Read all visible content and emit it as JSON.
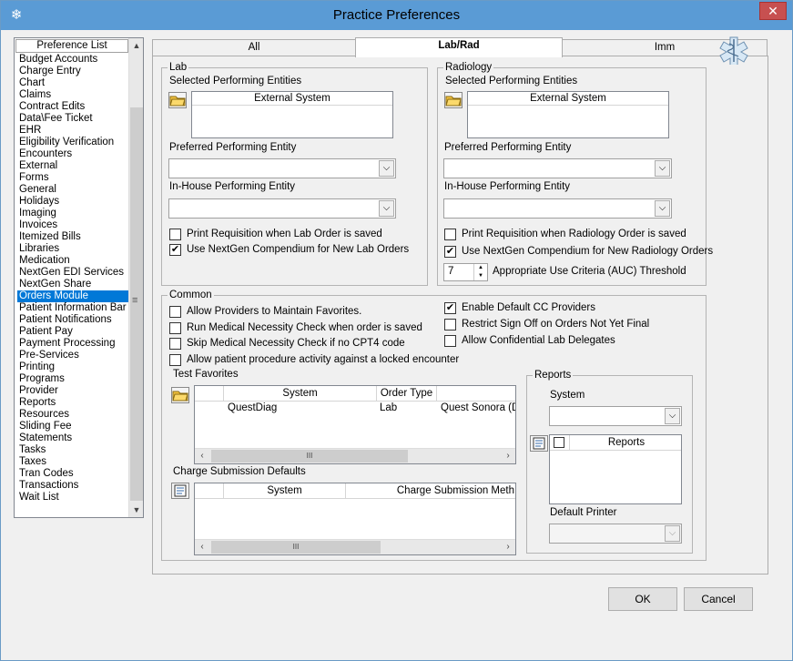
{
  "window": {
    "title": "Practice Preferences",
    "close_glyph": "✕",
    "app_icon": "❄"
  },
  "preference_list": {
    "header": "Preference List",
    "selected_index": 20,
    "items": [
      "Budget Accounts",
      "Charge Entry",
      "Chart",
      "Claims",
      "Contract Edits",
      "Data\\Fee Ticket",
      "EHR",
      "Eligibility Verification",
      "Encounters",
      "External",
      "Forms",
      "General",
      "Holidays",
      "Imaging",
      "Invoices",
      "Itemized Bills",
      "Libraries",
      "Medication",
      "NextGen EDI Services",
      "NextGen Share",
      "Orders Module",
      "Patient Information Bar",
      "Patient Notifications",
      "Patient Pay",
      "Payment Processing",
      "Pre-Services",
      "Printing",
      "Programs",
      "Provider",
      "Reports",
      "Resources",
      "Sliding Fee",
      "Statements",
      "Tasks",
      "Taxes",
      "Tran Codes",
      "Transactions",
      "Wait List"
    ],
    "scroll_up": "▲",
    "scroll_down": "▼",
    "grip": "≡"
  },
  "tabs": [
    {
      "label": "All",
      "active": false
    },
    {
      "label": "Lab/Rad",
      "active": true
    },
    {
      "label": "Imm",
      "active": false
    }
  ],
  "lab": {
    "legend": "Lab",
    "selected_entities_label": "Selected Performing Entities",
    "selected_entities_col": "External System",
    "preferred_label": "Preferred Performing Entity",
    "preferred_value": "",
    "inhouse_label": "In-House Performing Entity",
    "inhouse_value": "",
    "print_req_label": "Print Requisition when Lab Order is saved",
    "print_req_checked": false,
    "compendium_label": "Use NextGen Compendium for New Lab Orders",
    "compendium_checked": true
  },
  "radiology": {
    "legend": "Radiology",
    "selected_entities_label": "Selected Performing Entities",
    "selected_entities_col": "External System",
    "preferred_label": "Preferred Performing Entity",
    "preferred_value": "",
    "inhouse_label": "In-House Performing Entity",
    "inhouse_value": "",
    "print_req_label": "Print Requisition when Radiology Order is saved",
    "print_req_checked": false,
    "compendium_label": "Use NextGen Compendium for New Radiology Orders",
    "compendium_checked": true,
    "auc_value": "7",
    "auc_label": "Appropriate Use Criteria (AUC) Threshold"
  },
  "common": {
    "legend": "Common",
    "left_checks": [
      {
        "label": "Allow Providers to Maintain Favorites.",
        "checked": false
      },
      {
        "label": "Run Medical Necessity Check when order is saved",
        "checked": false
      },
      {
        "label": "Skip Medical Necessity Check if no CPT4 code",
        "checked": false
      },
      {
        "label": "Allow patient procedure activity against a locked encounter",
        "checked": false
      }
    ],
    "right_checks": [
      {
        "label": "Enable Default CC Providers",
        "checked": true
      },
      {
        "label": "Restrict Sign Off on Orders Not Yet Final",
        "checked": false
      },
      {
        "label": "Allow Confidential Lab Delegates",
        "checked": false
      }
    ],
    "test_favorites": {
      "label": "Test Favorites",
      "columns": [
        "System",
        "Order Type"
      ],
      "rows": [
        {
          "system": "QuestDiag",
          "order_type": "Lab",
          "extra": "Quest Sonora (D"
        }
      ]
    },
    "charge_submission": {
      "label": "Charge Submission Defaults",
      "columns": [
        "System",
        "Charge Submission Meth"
      ]
    },
    "reports": {
      "legend": "Reports",
      "system_label": "System",
      "system_value": "",
      "grid_col": "Reports",
      "default_printer_label": "Default Printer",
      "default_printer_value": ""
    }
  },
  "scroll_thumb_glyph": "III",
  "checkmark": "✔",
  "dropdown_glyph": "⌵",
  "buttons": {
    "ok": "OK",
    "cancel": "Cancel"
  }
}
